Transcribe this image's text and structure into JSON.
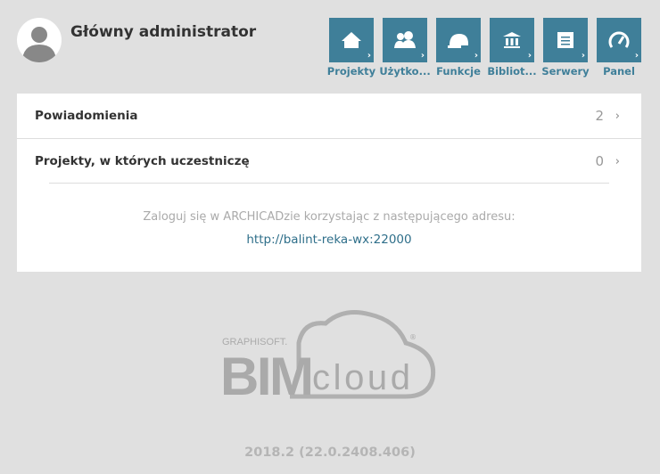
{
  "header": {
    "title": "Główny administrator"
  },
  "nav": [
    {
      "label": "Projekty",
      "icon": "house-icon"
    },
    {
      "label": "Użytko...",
      "icon": "users-icon"
    },
    {
      "label": "Funkcje",
      "icon": "hardhat-icon"
    },
    {
      "label": "Bibliot...",
      "icon": "library-icon"
    },
    {
      "label": "Serwery",
      "icon": "server-icon"
    },
    {
      "label": "Panel",
      "icon": "gauge-icon"
    }
  ],
  "rows": [
    {
      "label": "Powiadomienia",
      "count": "2"
    },
    {
      "label": "Projekty, w których uczestniczę",
      "count": "0"
    }
  ],
  "login_hint": "Zaloguj się w ARCHICADzie korzystając z następującego adresu:",
  "login_url": "http://balint-reka-wx:22000",
  "logo": {
    "brand": "GRAPHISOFT",
    "product": "BIMcloud"
  },
  "version": "2018.2 (22.0.2408.406)",
  "colors": {
    "accent": "#3f7f99",
    "background": "#e0e0e0"
  }
}
